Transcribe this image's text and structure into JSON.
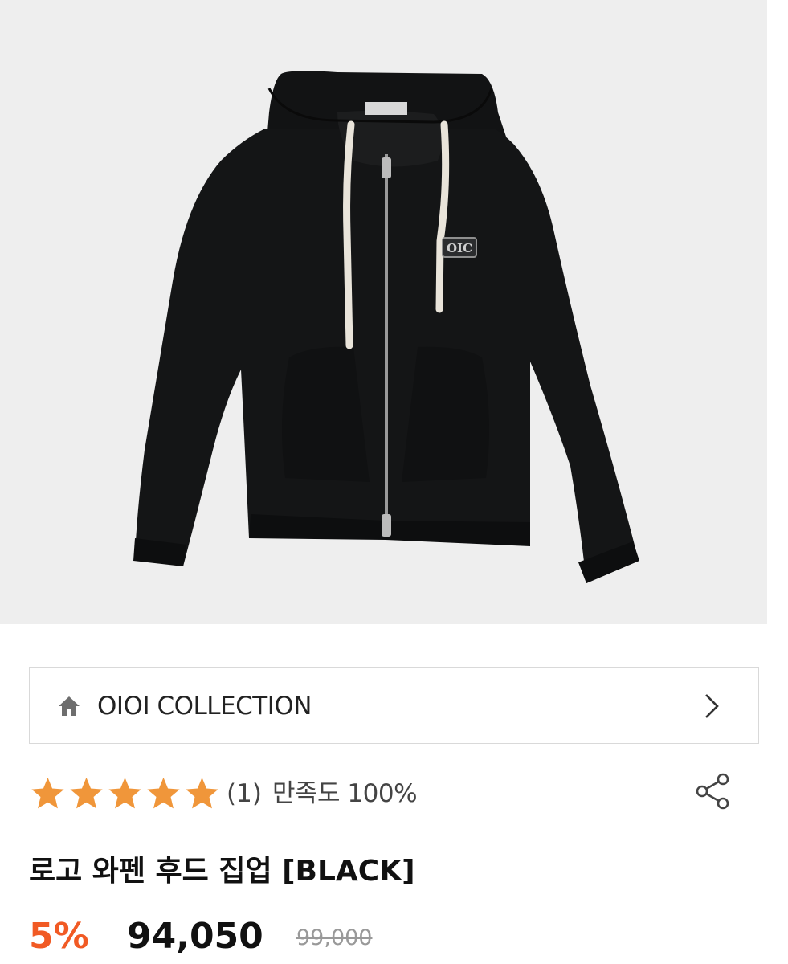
{
  "product_image": {
    "alt": "hoodie-photo",
    "background": "#eeeeee",
    "logo_text": "OIC"
  },
  "brand": {
    "name": "OIOI COLLECTION",
    "icon": "home-icon",
    "chevron": "chevron-right-icon"
  },
  "rating": {
    "stars_filled": 5,
    "stars_total": 5,
    "star_color": "#f0963a",
    "count": "(1)",
    "satisfaction": "만족도 100%"
  },
  "share": {
    "icon": "share-icon"
  },
  "product": {
    "title": "로고 와펜 후드 집업 [BLACK]"
  },
  "price": {
    "discount": "5%",
    "discount_color": "#f15a24",
    "sale": "94,050",
    "original": "99,000"
  }
}
